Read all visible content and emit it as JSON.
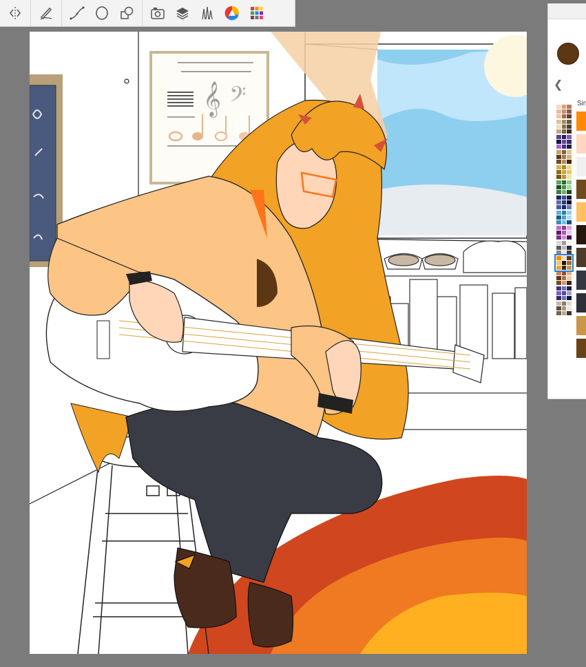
{
  "toolbar": {
    "groups": [
      [
        "symmetry-icon"
      ],
      [
        "pen-pressure-icon"
      ],
      [
        "curve-icon",
        "ellipse-icon",
        "shapes-icon"
      ],
      [
        "reference-icon",
        "layers-icon",
        "brush-set-icon",
        "color-wheel-icon",
        "palette-icon"
      ]
    ]
  },
  "color_panel": {
    "current_color": "#5b3713",
    "back_icon": "chevron-left-icon",
    "set_label": "Sin",
    "selected_set_index": 10,
    "color_sets": [
      [
        "#f5d8c8",
        "#d9a27c",
        "#b97c5d",
        "#e8b9a0",
        "#c78b6b",
        "#8c5a42",
        "#f0c4b0",
        "#a56b4e",
        "#6b3f2c"
      ],
      [
        "#d4c4a6",
        "#a48860",
        "#6e5a3c",
        "#ecdcc2",
        "#8a7250",
        "#4e3f2a",
        "#c0a880",
        "#7a6244",
        "#3a2e1e"
      ],
      [
        "#5b3f8f",
        "#2b1f5c",
        "#8c5ab4",
        "#1a1440",
        "#6b3f9f",
        "#3b2a70",
        "#a070c8",
        "#4a3080",
        "#241a50"
      ],
      [
        "#c8a070",
        "#8c6038",
        "#e0c090",
        "#5c3a1c",
        "#a07848",
        "#d8b080",
        "#704a28",
        "#b88858",
        "#3e2410"
      ],
      [
        "#d4b450",
        "#a88a2c",
        "#f0d878",
        "#8c7020",
        "#c8a440",
        "#e4c860",
        "#6e581a",
        "#b8943c",
        "#f4e094"
      ],
      [
        "#5ca05c",
        "#2e6e2e",
        "#8cc88c",
        "#1e4e1e",
        "#4c904c",
        "#a0d8a0",
        "#3a7e3a",
        "#6cb06c",
        "#165016"
      ],
      [
        "#1e2a5c",
        "#3a4a8c",
        "#121a3c",
        "#5a6aac",
        "#2a3a7c",
        "#0a1230",
        "#4a5a9c",
        "#1a2a6c",
        "#6a7abc"
      ],
      [
        "#5cb0d8",
        "#2e7ea8",
        "#8cd0f0",
        "#1e5e88",
        "#4ca0c8",
        "#a0e0f8",
        "#3a8eb8",
        "#6cc0e8",
        "#165080"
      ],
      [
        "#c070c8",
        "#8c3e98",
        "#e0a0e8",
        "#5c1e68",
        "#a858b0",
        "#f0c0f4",
        "#7c3488",
        "#d088d8",
        "#4e1458"
      ],
      [
        "#d8d8d8",
        "#9c9c9c",
        "#f4f4f4",
        "#5c5c5c",
        "#bcbcbc",
        "#2c2c2c",
        "#888888",
        "#e8e8e8",
        "#444444"
      ],
      [
        "#ff8a00",
        "#ffd7c0",
        "#5b3713",
        "#ffc060",
        "#1e1408",
        "#a86e30",
        "#f0a040",
        "#3a2a1c",
        "#c89848"
      ],
      [
        "#c88858",
        "#8c5428",
        "#e8b088",
        "#5c3418",
        "#a87048",
        "#f4c8a0",
        "#7c4a28",
        "#d49868",
        "#3e2010"
      ],
      [
        "#3a3a7c",
        "#6c6cb0",
        "#1e1e4c",
        "#8c5ab4",
        "#4c4c9c",
        "#a0a0d8",
        "#2a2a6c",
        "#7070c0",
        "#14143c"
      ],
      [
        "#c8b8a0",
        "#8c7c64",
        "#e4d8c4",
        "#5c5040",
        "#a8987e",
        "#f0e8dc",
        "#706450",
        "#b8a890",
        "#3e3428"
      ]
    ],
    "big_swatches": [
      "#ff8a00",
      "#ffd7c0",
      "#f0f0f0",
      "#6e4a1e",
      "#ffc060",
      "#24170b",
      "#4e3a28",
      "#35383e",
      "#2c2f36",
      "#c89848",
      "#6a4414"
    ]
  }
}
